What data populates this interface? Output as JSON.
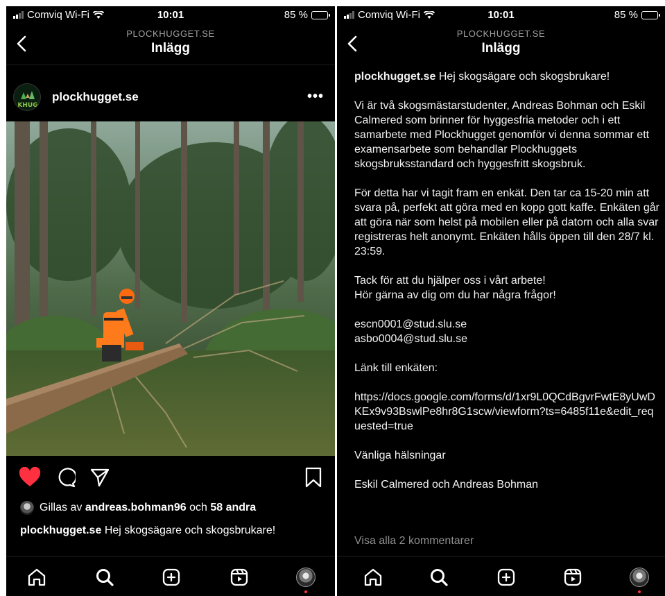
{
  "status": {
    "carrier": "Comviq Wi-Fi",
    "time": "10:01",
    "battery_left": "85 %",
    "battery_right": "85 %"
  },
  "header": {
    "kicker": "PLOCKHUGGET.SE",
    "title": "Inlägg"
  },
  "post": {
    "username": "plockhugget.se",
    "avatar_text": "KHUG",
    "more_label": "•••",
    "liked_prefix": "Gillas av",
    "liked_user": "andreas.bohman96",
    "liked_mid": "och",
    "liked_count": "58 andra",
    "caption_user": "plockhugget.se",
    "caption_text": "Hej skogsägare och skogsbrukare!"
  },
  "caption_full": {
    "greeting": "Hej skogsägare och skogsbrukare!",
    "para1": "Vi är två skogsmästarstudenter, Andreas Bohman och Eskil Calmered som brinner för hyggesfria metoder och i ett samarbete med Plockhugget genomför vi denna sommar ett examensarbete som behandlar Plockhuggets skogsbruksstandard och hyggesfritt skogsbruk.",
    "para2": "För detta har vi tagit fram en enkät. Den tar ca 15-20 min att svara på, perfekt att göra med en kopp gott kaffe. Enkäten går att göra när som helst på mobilen eller på datorn och alla svar registreras helt anonymt. Enkäten hålls öppen till den 28/7 kl. 23:59.",
    "para3": "Tack för att du hjälper oss i vårt arbete!\nHör gärna av dig om du har några frågor!",
    "email1": "escn0001@stud.slu.se",
    "email2": "asbo0004@stud.slu.se",
    "link_label": "Länk till enkäten:",
    "link_url": "https://docs.google.com/forms/d/1xr9L0QCdBgvrFwtE8yUwDKEx9v93BswlPe8hr8G1scw/viewform?ts=6485f11e&edit_requested=true",
    "signoff": "Vänliga hälsningar",
    "signature": "Eskil Calmered och Andreas Bohman",
    "view_comments": "Visa alla 2 kommentarer"
  },
  "colors": {
    "background": "#000000",
    "like_red": "#ff3040",
    "muted": "#8e8e8e"
  },
  "icons": [
    "back-icon",
    "more-icon",
    "heart-icon",
    "comment-icon",
    "share-icon",
    "bookmark-icon",
    "home-icon",
    "search-icon",
    "create-icon",
    "reels-icon",
    "profile-icon"
  ]
}
